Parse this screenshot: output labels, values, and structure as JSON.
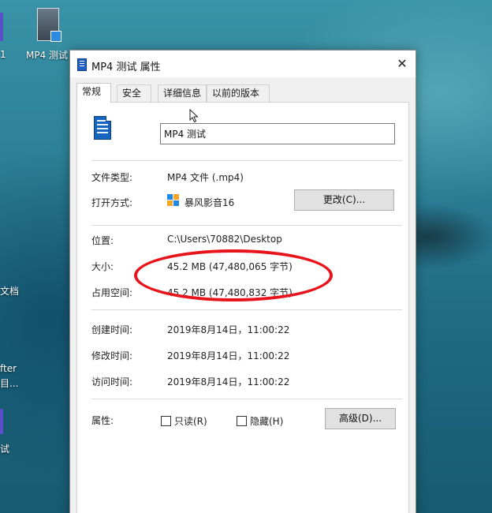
{
  "desktop": {
    "icon_label": "MP4 测试",
    "left_edge_labels": [
      "1",
      "文档",
      "fter",
      "目...",
      "试"
    ]
  },
  "dialog": {
    "title": "MP4 测试 属性",
    "tabs": [
      "常规",
      "安全",
      "详细信息",
      "以前的版本"
    ],
    "file_name": "MP4 测试",
    "rows": {
      "file_type_label": "文件类型:",
      "file_type_value": "MP4 文件 (.mp4)",
      "open_with_label": "打开方式:",
      "open_with_value": "暴风影音16",
      "change_button": "更改(C)...",
      "location_label": "位置:",
      "location_value": "C:\\Users\\70882\\Desktop",
      "size_label": "大小:",
      "size_value": "45.2 MB (47,480,065 字节)",
      "disk_size_label": "占用空间:",
      "disk_size_value": "45.2 MB (47,480,832 字节)",
      "created_label": "创建时间:",
      "created_value": "2019年8月14日，11:00:22",
      "modified_label": "修改时间:",
      "modified_value": "2019年8月14日，11:00:22",
      "accessed_label": "访问时间:",
      "accessed_value": "2019年8月14日，11:00:22",
      "attributes_label": "属性:",
      "readonly_label": "只读(R)",
      "hidden_label": "隐藏(H)",
      "advanced_button": "高级(D)..."
    },
    "close_glyph": "✕"
  },
  "colors": {
    "annotation_red": "#e8141b",
    "file_icon_blue": "#1565c0"
  }
}
